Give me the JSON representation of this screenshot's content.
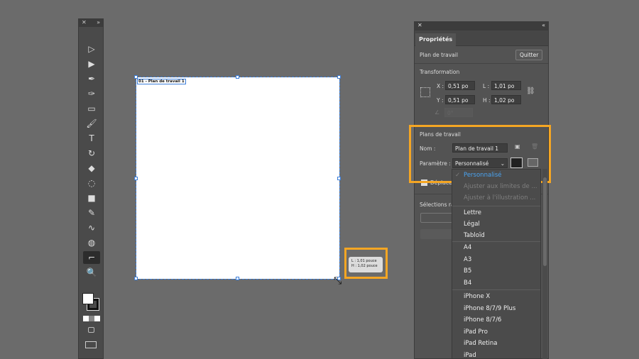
{
  "toolbar": {
    "close": "✕",
    "collapse": "»",
    "tools": [
      {
        "name": "selection-tool",
        "glyph": "▷"
      },
      {
        "name": "direct-selection-tool",
        "glyph": "▶"
      },
      {
        "name": "pen-tool",
        "glyph": "✒"
      },
      {
        "name": "curvature-tool",
        "glyph": "✑"
      },
      {
        "name": "rectangle-tool",
        "glyph": "▭"
      },
      {
        "name": "paintbrush-tool",
        "glyph": "🖌"
      },
      {
        "name": "type-tool",
        "glyph": "T"
      },
      {
        "name": "rotate-tool",
        "glyph": "↻"
      },
      {
        "name": "eraser-tool",
        "glyph": "◆"
      },
      {
        "name": "lasso-tool",
        "glyph": "◌"
      },
      {
        "name": "gradient-tool",
        "glyph": "■"
      },
      {
        "name": "eyedropper-tool",
        "glyph": "✎"
      },
      {
        "name": "puppet-warp-tool",
        "glyph": "∿"
      },
      {
        "name": "shape-builder-tool",
        "glyph": "◍"
      },
      {
        "name": "artboard-tool",
        "glyph": "⌐"
      },
      {
        "name": "zoom-tool",
        "glyph": "🔍"
      }
    ]
  },
  "canvas": {
    "artboard_label": "01 - Plan de travail 1",
    "tooltip": {
      "width": "L : 1,01 pouce",
      "height": "H : 1,02 pouce"
    }
  },
  "panel": {
    "close": "✕",
    "collapse": "«",
    "tab": "Propriétés",
    "section_artboard": "Plan de travail",
    "quit_button": "Quitter",
    "transform_title": "Transformation",
    "x_label": "X :",
    "x_value": "0,51 po",
    "y_label": "Y :",
    "y_value": "0,51 po",
    "w_label": "L :",
    "w_value": "1,01 po",
    "h_label": "H :",
    "h_value": "1,02 po",
    "angle_value": "0°",
    "artboards_title": "Plans de travail",
    "name_label": "Nom :",
    "name_value": "Plan de travail 1",
    "preset_label": "Paramètre :",
    "preset_value": "Personnalisé",
    "move_label": "Déplacer",
    "quick_sel_label": "Sélections ra"
  },
  "dropdown": {
    "selected": "Personnalisé",
    "disabled": [
      "Ajuster aux limites de ...",
      "Ajuster à l'illustration ..."
    ],
    "group1": [
      "Lettre",
      "Légal",
      "Tabloïd"
    ],
    "group2": [
      "A4",
      "A3",
      "B5",
      "B4"
    ],
    "group3": [
      "iPhone X",
      "iPhone 8/7/9 Plus",
      "iPhone 8/7/6",
      "iPad Pro",
      "iPad Retina",
      "iPad"
    ]
  },
  "colors": {
    "highlight": "#f5a623",
    "selection": "#3b7dd8",
    "selected_option": "#4aa3f0"
  }
}
